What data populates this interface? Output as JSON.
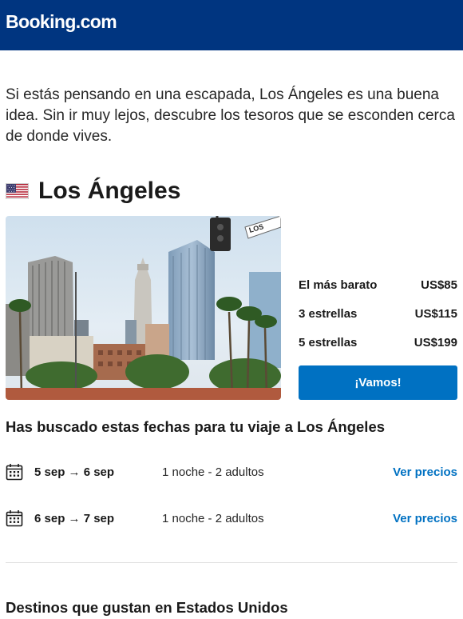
{
  "header": {
    "logo_text": "Booking.com",
    "brand_color": "#003580"
  },
  "intro": {
    "text": "Si estás pensando en una escapada, Los Ángeles es una buena idea. Sin ir muy lejos, descubre los tesoros que se esconden cerca de donde vives."
  },
  "destination": {
    "flag_icon": "us-flag-icon",
    "city": "Los Ángeles",
    "photo_icon": "los-angeles-skyline-photo",
    "street_sign_text": "LOS",
    "prices": [
      {
        "label": "El más barato",
        "value": "US$85"
      },
      {
        "label": "3 estrellas",
        "value": "US$115"
      },
      {
        "label": "5 estrellas",
        "value": "US$199"
      }
    ],
    "cta_label": "¡Vamos!",
    "cta_color": "#0071c2"
  },
  "searched": {
    "title": "Has buscado estas fechas para tu viaje a Los Ángeles",
    "rows": [
      {
        "icon": "calendar-icon",
        "dates": "5 sep → 6 sep",
        "detail": "1 noche - 2 adultos",
        "link": "Ver precios"
      },
      {
        "icon": "calendar-icon",
        "dates": "6 sep → 7 sep",
        "detail": "1 noche - 2 adultos",
        "link": "Ver precios"
      }
    ]
  },
  "popular": {
    "title": "Destinos que gustan en Estados Unidos"
  }
}
